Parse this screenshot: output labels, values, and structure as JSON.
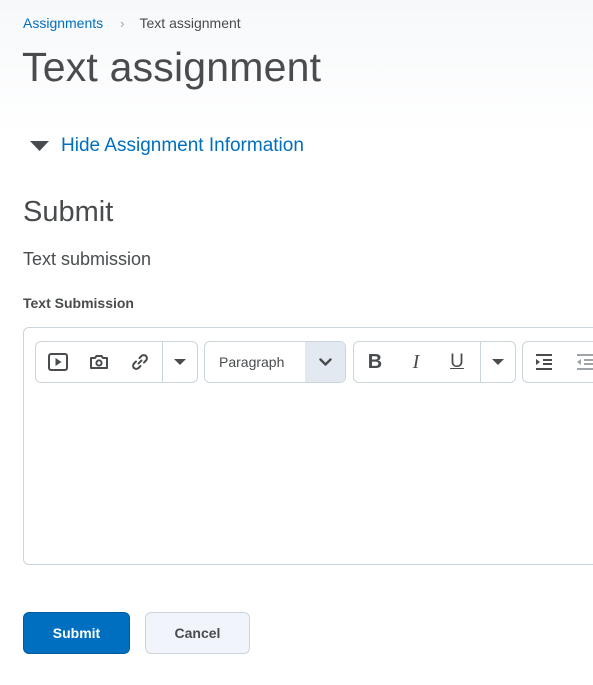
{
  "breadcrumb": {
    "parent": "Assignments",
    "separator": "›",
    "current": "Text assignment"
  },
  "page": {
    "title": "Text assignment"
  },
  "assignment_info": {
    "toggle_label": "Hide Assignment Information"
  },
  "submit_section": {
    "heading": "Submit",
    "submission_type": "Text submission",
    "field_label": "Text Submission"
  },
  "editor": {
    "toolbar": {
      "insert_group": [
        "video-icon",
        "camera-icon",
        "link-icon",
        "dropdown-caret-icon"
      ],
      "format_select": {
        "value": "Paragraph"
      },
      "style_group": {
        "bold": "B",
        "italic": "I",
        "underline": "U"
      },
      "indent_group": [
        "indent-icon",
        "outdent-icon"
      ]
    },
    "content": ""
  },
  "actions": {
    "submit_label": "Submit",
    "cancel_label": "Cancel"
  },
  "colors": {
    "link": "#006fbf",
    "primary_button": "#006fbf",
    "text": "#494c4e",
    "border": "#cdd5dc"
  }
}
